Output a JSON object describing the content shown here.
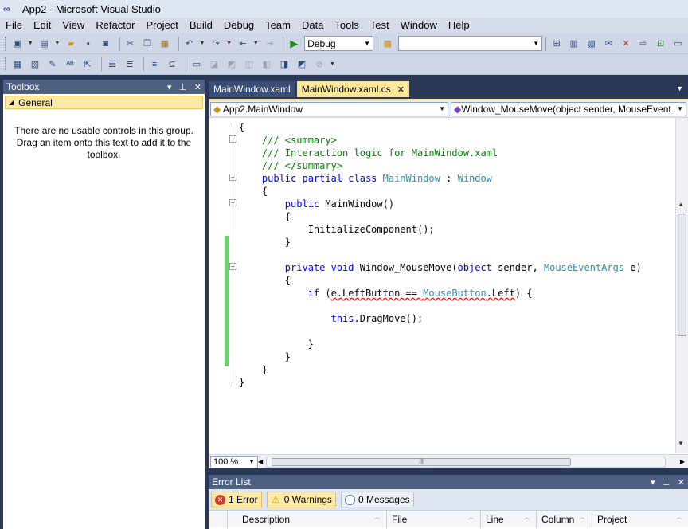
{
  "window": {
    "title": "App2 - Microsoft Visual Studio"
  },
  "menu": [
    "File",
    "Edit",
    "View",
    "Refactor",
    "Project",
    "Build",
    "Debug",
    "Team",
    "Data",
    "Tools",
    "Test",
    "Window",
    "Help"
  ],
  "toolbar": {
    "config_value": "Debug",
    "find_value": ""
  },
  "toolbox": {
    "title": "Toolbox",
    "pin": "↕",
    "close": "✕",
    "group": "General",
    "empty_message": "There are no usable controls in this group. Drag an item onto this text to add it to the toolbox."
  },
  "tabs": [
    {
      "label": "MainWindow.xaml",
      "active": false
    },
    {
      "label": "MainWindow.xaml.cs",
      "active": true
    }
  ],
  "editor": {
    "type_combo": "App2.MainWindow",
    "member_combo": "Window_MouseMove(object sender, MouseEvent"
  },
  "code_lines": [
    [
      {
        "t": "{"
      }
    ],
    [
      {
        "t": "    "
      },
      {
        "t": "/// <summary>",
        "c": "cm"
      }
    ],
    [
      {
        "t": "    "
      },
      {
        "t": "/// Interaction logic for MainWindow.xaml",
        "c": "cm"
      }
    ],
    [
      {
        "t": "    "
      },
      {
        "t": "/// </summary>",
        "c": "cm"
      }
    ],
    [
      {
        "t": "    "
      },
      {
        "t": "public partial class ",
        "c": "kw"
      },
      {
        "t": "MainWindow",
        "c": "ty"
      },
      {
        "t": " : "
      },
      {
        "t": "Window",
        "c": "ty"
      }
    ],
    [
      {
        "t": "    {"
      }
    ],
    [
      {
        "t": "        "
      },
      {
        "t": "public ",
        "c": "kw"
      },
      {
        "t": "MainWindow()"
      }
    ],
    [
      {
        "t": "        {"
      }
    ],
    [
      {
        "t": "            InitializeComponent();"
      }
    ],
    [
      {
        "t": "        }"
      }
    ],
    [
      {
        "t": ""
      }
    ],
    [
      {
        "t": "        "
      },
      {
        "t": "private void ",
        "c": "kw"
      },
      {
        "t": "Window_MouseMove("
      },
      {
        "t": "object",
        "c": "kw"
      },
      {
        "t": " sender, "
      },
      {
        "t": "MouseEventArgs",
        "c": "ty"
      },
      {
        "t": " e)"
      }
    ],
    [
      {
        "t": "        {"
      }
    ],
    [
      {
        "t": "            "
      },
      {
        "t": "if",
        "c": "kw"
      },
      {
        "t": " ("
      },
      {
        "t": "e.LeftButton == ",
        "c": "err"
      },
      {
        "t": "MouseButton",
        "c": "ty err"
      },
      {
        "t": ".Left",
        "c": "err"
      },
      {
        "t": ") {"
      }
    ],
    [
      {
        "t": ""
      }
    ],
    [
      {
        "t": "                "
      },
      {
        "t": "this",
        "c": "kw"
      },
      {
        "t": ".DragMove();"
      }
    ],
    [
      {
        "t": ""
      }
    ],
    [
      {
        "t": "            }"
      }
    ],
    [
      {
        "t": "        }"
      }
    ],
    [
      {
        "t": "    }"
      }
    ],
    [
      {
        "t": "}"
      }
    ]
  ],
  "zoom": "100 %",
  "error_list": {
    "title": "Error List",
    "errors": "1 Error",
    "warnings": "0 Warnings",
    "messages": "0 Messages",
    "columns": [
      "Description",
      "File",
      "Line",
      "Column",
      "Project"
    ]
  }
}
